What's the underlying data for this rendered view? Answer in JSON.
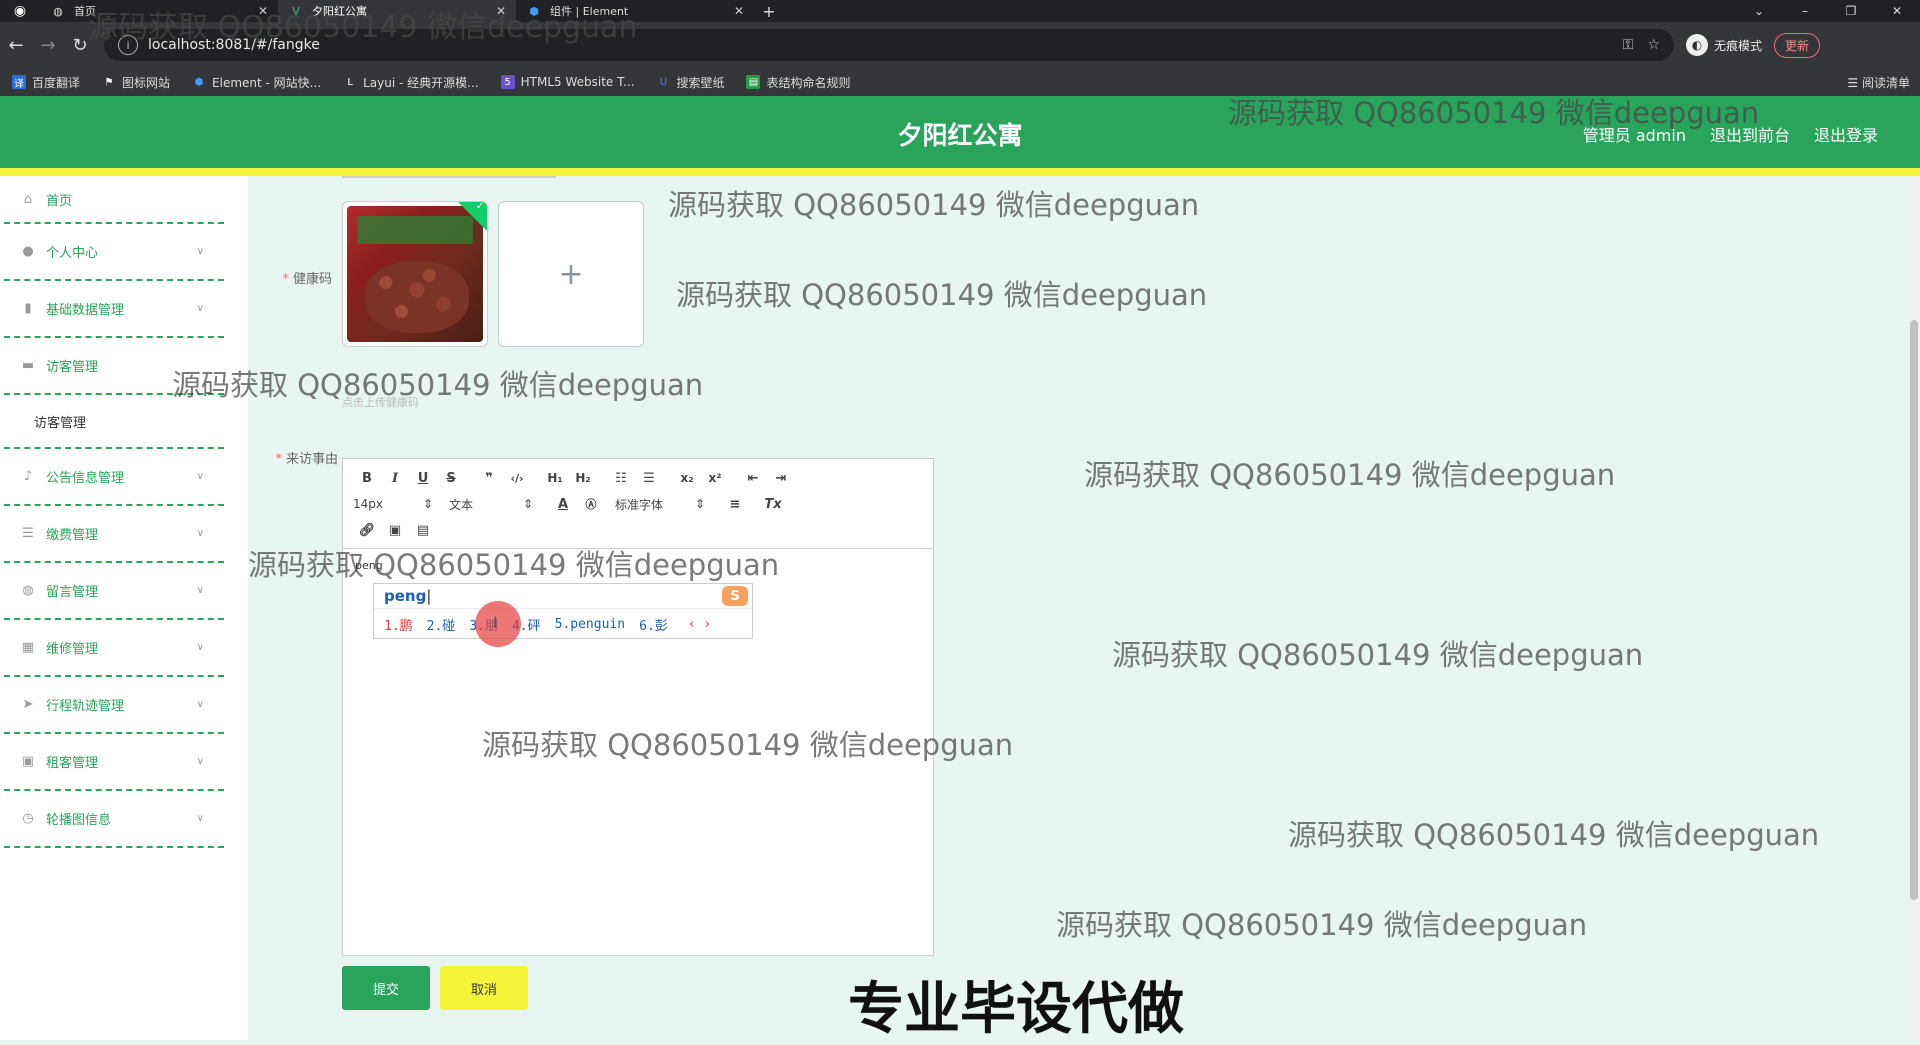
{
  "browser": {
    "tabs": [
      {
        "title": "首页",
        "icon": "globe-icon"
      },
      {
        "title": "夕阳红公寓",
        "icon": "vue-icon"
      },
      {
        "title": "组件 | Element",
        "icon": "element-icon"
      }
    ],
    "url": "localhost:8081/#/fangke",
    "incognito_label": "无痕模式",
    "update_label": "更新",
    "bookmarks": [
      "百度翻译",
      "图标网站",
      "Element - 网站快...",
      "Layui - 经典开源模...",
      "HTML5 Website T...",
      "搜索壁纸",
      "表结构命名规则"
    ],
    "reading_list": "阅读清单"
  },
  "header": {
    "title": "夕阳红公寓",
    "admin_label": "管理员 admin",
    "front_link": "退出到前台",
    "logout_link": "退出登录",
    "colors": {
      "primary": "#2aa35b",
      "accent": "#f7f53a"
    }
  },
  "sidebar": {
    "items": [
      {
        "label": "首页",
        "icon": "home-icon"
      },
      {
        "label": "个人中心",
        "icon": "user-icon"
      },
      {
        "label": "基础数据管理",
        "icon": "chart-icon"
      },
      {
        "label": "访客管理",
        "icon": "monitor-icon"
      },
      {
        "label": "访客管理",
        "icon": ""
      },
      {
        "label": "公告信息管理",
        "icon": "mic-icon"
      },
      {
        "label": "缴费管理",
        "icon": "sliders-icon"
      },
      {
        "label": "留言管理",
        "icon": "globe-icon"
      },
      {
        "label": "维修管理",
        "icon": "grid-icon"
      },
      {
        "label": "行程轨迹管理",
        "icon": "location-icon"
      },
      {
        "label": "租客管理",
        "icon": "clipboard-icon"
      },
      {
        "label": "轮播图信息",
        "icon": "clock-icon"
      }
    ]
  },
  "form": {
    "health_code_label": "健康码",
    "upload_plus": "+",
    "upload_hint": "点击上传健康码",
    "reason_label": "来访事由",
    "editor": {
      "font_size": "14px",
      "header_select": "文本",
      "font_family": "标准字体",
      "content": "peng"
    },
    "ime": {
      "input": "peng",
      "candidates": [
        "1.鹏",
        "2.碰",
        "3.朋",
        "4.砰",
        "5.penguin",
        "6.彭"
      ],
      "logo": "S"
    },
    "submit_label": "提交",
    "cancel_label": "取消"
  },
  "watermarks": {
    "text": "源码获取 QQ86050149 微信deepguan",
    "banner": "专业毕设代做"
  }
}
